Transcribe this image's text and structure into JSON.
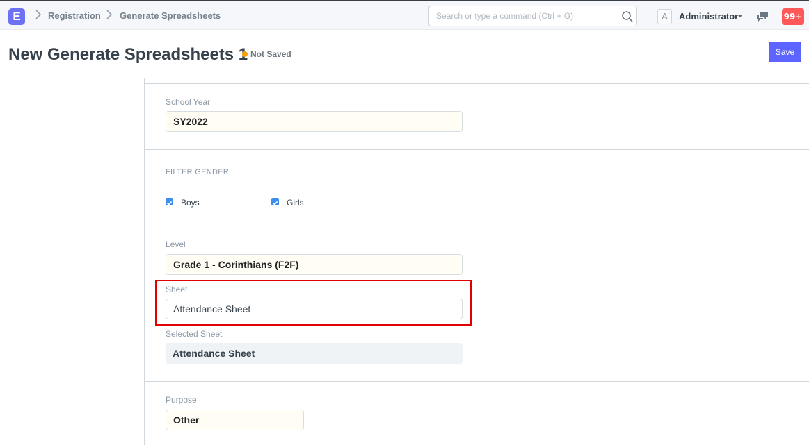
{
  "navbar": {
    "logo_letter": "E",
    "breadcrumbs": [
      "Registration",
      "Generate Spreadsheets"
    ],
    "search_placeholder": "Search or type a command (Ctrl + G)",
    "avatar_letter": "A",
    "user_name": "Administrator",
    "notification_count": "99+"
  },
  "page": {
    "title": "New Generate Spreadsheets 1",
    "status": "Not Saved",
    "save_label": "Save"
  },
  "form": {
    "school_year": {
      "label": "School Year",
      "value": "SY2022"
    },
    "filter_gender": {
      "heading": "FILTER GENDER",
      "options": [
        {
          "label": "Boys",
          "checked": true
        },
        {
          "label": "Girls",
          "checked": true
        }
      ]
    },
    "level": {
      "label": "Level",
      "value": "Grade 1 - Corinthians (F2F)"
    },
    "sheet": {
      "label": "Sheet",
      "value": "Attendance Sheet"
    },
    "selected_sheet": {
      "label": "Selected Sheet",
      "value": "Attendance Sheet"
    },
    "purpose": {
      "label": "Purpose",
      "value": "Other"
    }
  },
  "colors": {
    "brand": "#6d72f5",
    "primary_button": "#5e64ff",
    "not_saved_dot": "#ffa00a",
    "notification_badge": "#ff5858",
    "checkbox": "#3d8eed",
    "highlight": "#e00000"
  },
  "icons": [
    "search-icon",
    "chat-icon",
    "caret-down-icon",
    "chevron-right-icon",
    "checkbox-checked-icon"
  ]
}
